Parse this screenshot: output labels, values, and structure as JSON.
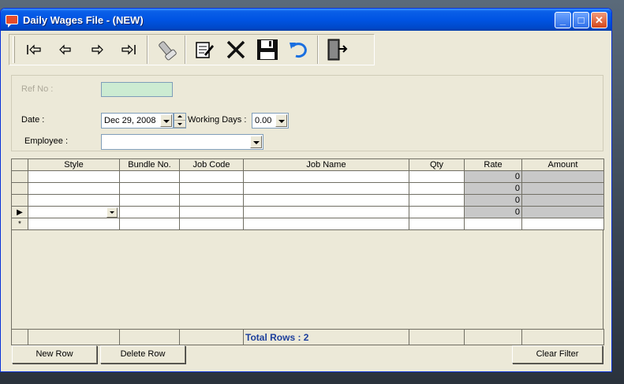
{
  "window": {
    "title": "Daily Wages File - (NEW)",
    "icon": "app-form-icon"
  },
  "toolbar": {
    "buttons": [
      {
        "name": "first-record",
        "icon": "first-icon"
      },
      {
        "name": "previous-record",
        "icon": "arrow-left-icon"
      },
      {
        "name": "next-record",
        "icon": "arrow-right-icon"
      },
      {
        "name": "last-record",
        "icon": "last-icon"
      },
      {
        "name": "find",
        "icon": "flashlight-icon"
      },
      {
        "name": "edit",
        "icon": "edit-icon"
      },
      {
        "name": "delete",
        "icon": "delete-x-icon"
      },
      {
        "name": "save",
        "icon": "floppy-icon"
      },
      {
        "name": "undo",
        "icon": "undo-icon"
      },
      {
        "name": "exit",
        "icon": "exit-door-icon"
      }
    ]
  },
  "form": {
    "ref_no_label": "Ref No :",
    "ref_no_value": "",
    "date_label": "Date :",
    "date_value": "Dec 29, 2008",
    "working_days_label": "Working Days :",
    "working_days_value": "0.00",
    "employee_label": "Employee :",
    "employee_value": ""
  },
  "grid": {
    "columns": [
      "Style",
      "Bundle No.",
      "Job Code",
      "Job Name",
      "Qty",
      "Rate",
      "Amount"
    ],
    "rows": [
      {
        "style": "",
        "bundle": "",
        "job_code": "",
        "job_name": "",
        "qty": "",
        "rate": "0",
        "amount": ""
      },
      {
        "style": "",
        "bundle": "",
        "job_code": "",
        "job_name": "",
        "qty": "",
        "rate": "0",
        "amount": ""
      },
      {
        "style": "",
        "bundle": "",
        "job_code": "",
        "job_name": "",
        "qty": "",
        "rate": "0",
        "amount": ""
      },
      {
        "style": "",
        "bundle": "",
        "job_code": "",
        "job_name": "",
        "qty": "",
        "rate": "0",
        "amount": ""
      }
    ],
    "new_row_marker": "*",
    "current_row_marker": "▶",
    "footer_total": "Total Rows : 2"
  },
  "buttons": {
    "new_row": "New Row",
    "delete_row": "Delete Row",
    "clear_filter": "Clear Filter"
  },
  "colors": {
    "title_bar": "#0054e3",
    "ref_no_bg": "#ccebd2",
    "readonly_cell": "#c8c8c8",
    "total_text": "#1d3f9c"
  }
}
